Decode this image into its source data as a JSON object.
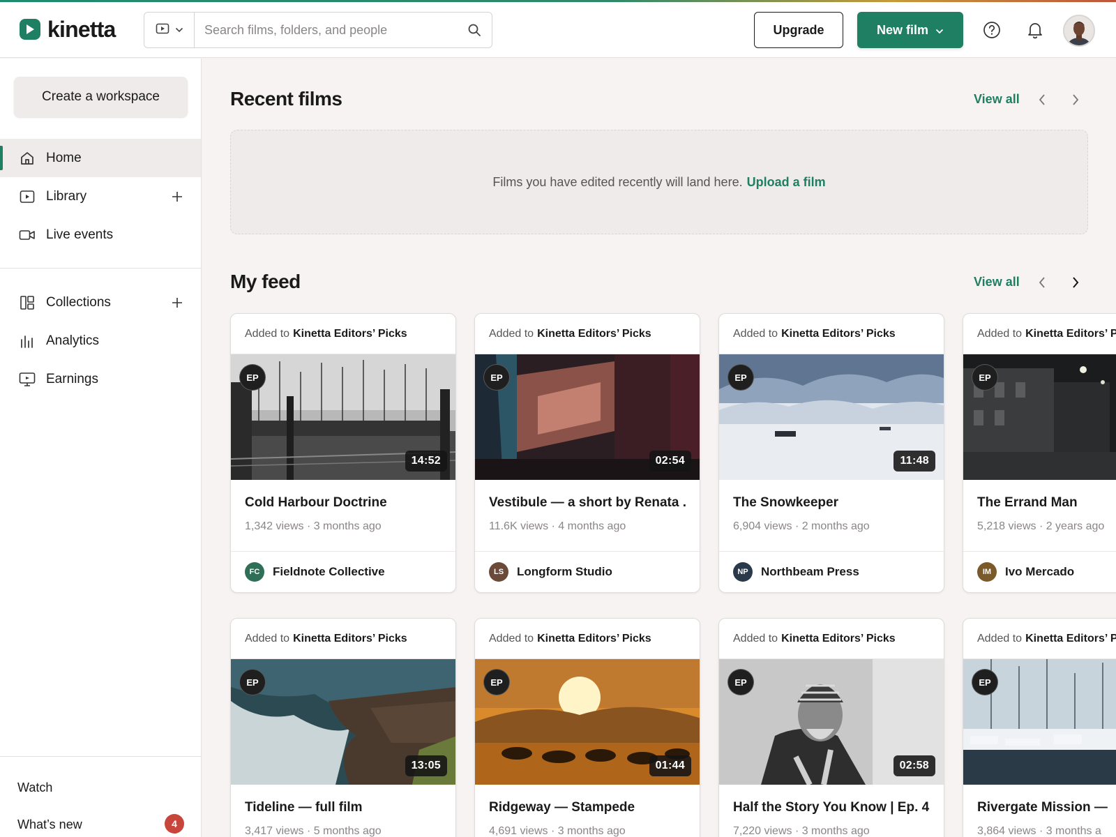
{
  "brand": {
    "name": "kinetta",
    "accent": "#1f7f63"
  },
  "header": {
    "search_placeholder": "Search films, folders, and people",
    "upgrade_label": "Upgrade",
    "new_film_label": "New film"
  },
  "sidebar": {
    "create_workspace": "Create a workspace",
    "items": [
      {
        "label": "Home",
        "icon": "home-icon",
        "active": true
      },
      {
        "label": "Library",
        "icon": "video-icon"
      },
      {
        "label": "Live events",
        "icon": "camera-icon"
      },
      {
        "label": "Collections",
        "icon": "collections-icon"
      },
      {
        "label": "Analytics",
        "icon": "analytics-icon"
      },
      {
        "label": "Earnings",
        "icon": "earnings-icon"
      }
    ],
    "footer": {
      "watch": "Watch",
      "whats_new": "What’s new",
      "whats_new_count": "4"
    }
  },
  "recent": {
    "title": "Recent films",
    "view_all": "View all",
    "empty_text": "Films you have edited recently will land here.",
    "empty_link": "Upload a film"
  },
  "feed": {
    "title": "My feed",
    "view_all": "View all",
    "added_prefix": "Added to",
    "added_target": "Kinetta Editors’ Picks",
    "ep_badge": "EP",
    "cards": [
      {
        "title": "Cold Harbour Doctrine",
        "meta": "1,342 views · 3 months ago",
        "duration": "14:52",
        "author": "Fieldnote Collective",
        "initials": "FC",
        "av_color": "#2f6e57"
      },
      {
        "title": "Vestibule — a short by Renata ...",
        "meta": "11.6K views · 4 months ago",
        "duration": "02:54",
        "author": "Longform Studio",
        "initials": "LS",
        "av_color": "#6b4a3a"
      },
      {
        "title": "The Snowkeeper",
        "meta": "6,904 views · 2 months ago",
        "duration": "11:48",
        "author": "Northbeam Press",
        "initials": "NP",
        "av_color": "#2b3a4a"
      },
      {
        "title": "The Errand Man",
        "meta": "5,218 views · 2 years ago",
        "duration": "",
        "author": "Ivo Mercado",
        "initials": "IM",
        "av_color": "#7a5a2a"
      },
      {
        "title": "Tideline — full film",
        "meta": "3,417 views · 5 months ago",
        "duration": "13:05"
      },
      {
        "title": "Ridgeway — Stampede",
        "meta": "4,691 views · 3 months ago",
        "duration": "01:44"
      },
      {
        "title": "Half the Story You Know | Ep. 4",
        "meta": "7,220 views · 3 months ago",
        "duration": "02:58"
      },
      {
        "title": "Rivergate Mission — be",
        "meta": "3,864 views · 3 months a",
        "duration": ""
      }
    ]
  }
}
